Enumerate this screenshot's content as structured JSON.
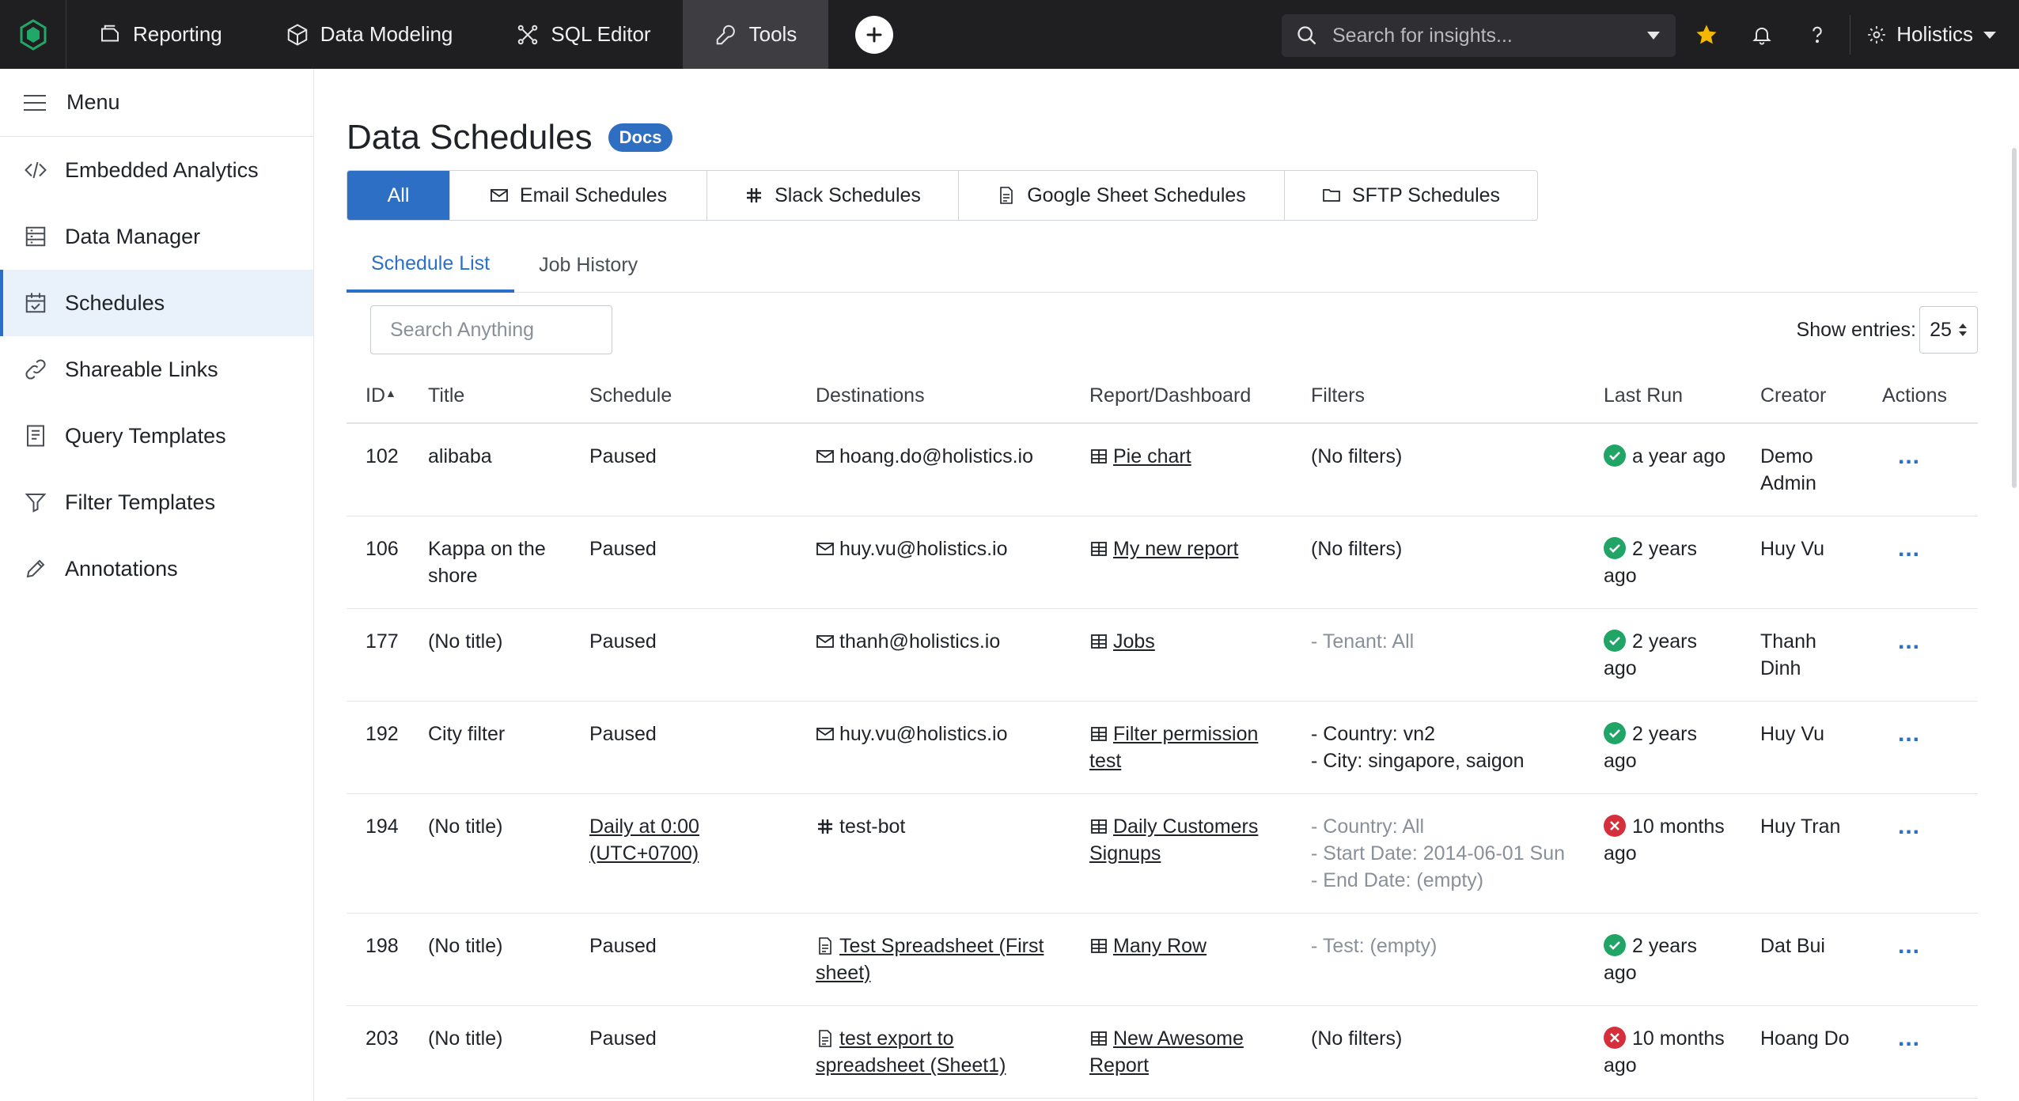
{
  "topbar": {
    "nav": [
      {
        "label": "Reporting",
        "icon": "reporting-icon"
      },
      {
        "label": "Data Modeling",
        "icon": "cube-icon"
      },
      {
        "label": "SQL Editor",
        "icon": "sql-editor-icon"
      },
      {
        "label": "Tools",
        "icon": "wrench-icon"
      }
    ],
    "active_nav": "Tools",
    "search_placeholder": "Search for insights...",
    "account_label": "Holistics",
    "accent_star": "#f5b800"
  },
  "sidebar": {
    "menu_label": "Menu",
    "items": [
      {
        "label": "Embedded Analytics",
        "icon": "code-icon"
      },
      {
        "label": "Data Manager",
        "icon": "data-manager-icon"
      },
      {
        "label": "Schedules",
        "icon": "calendar-check-icon"
      },
      {
        "label": "Shareable Links",
        "icon": "link-icon"
      },
      {
        "label": "Query Templates",
        "icon": "query-template-icon"
      },
      {
        "label": "Filter Templates",
        "icon": "filter-icon"
      },
      {
        "label": "Annotations",
        "icon": "pencil-icon"
      }
    ],
    "active_item": "Schedules"
  },
  "page": {
    "title": "Data Schedules",
    "docs_label": "Docs",
    "type_tabs": [
      "All",
      "Email Schedules",
      "Slack Schedules",
      "Google Sheet Schedules",
      "SFTP Schedules"
    ],
    "sub_tabs": [
      "Schedule List",
      "Job History"
    ],
    "search_placeholder": "Search Anything",
    "show_entries_label": "Show entries:",
    "show_entries_value": "25"
  },
  "table": {
    "columns": [
      "ID",
      "Title",
      "Schedule",
      "Destinations",
      "Report/Dashboard",
      "Filters",
      "Last Run",
      "Creator",
      "Actions"
    ],
    "actions_label": "...",
    "rows": [
      {
        "id": "102",
        "title": "alibaba",
        "schedule": "Paused",
        "destination": "hoang.do@holistics.io",
        "dest_type": "email",
        "report": "Pie chart",
        "filters": [
          "(No filters)"
        ],
        "last_run": "a year ago",
        "status": "success",
        "creator": "Demo Admin"
      },
      {
        "id": "106",
        "title": "Kappa on the shore",
        "schedule": "Paused",
        "destination": "huy.vu@holistics.io",
        "dest_type": "email",
        "report": "My new report",
        "filters": [
          "(No filters)"
        ],
        "last_run": "2 years ago",
        "status": "success",
        "creator": "Huy Vu"
      },
      {
        "id": "177",
        "title": "(No title)",
        "schedule": "Paused",
        "destination": "thanh@holistics.io",
        "dest_type": "email",
        "report": "Jobs",
        "filters": [
          "- Tenant: All"
        ],
        "last_run": "2 years ago",
        "status": "success",
        "creator": "Thanh Dinh"
      },
      {
        "id": "192",
        "title": "City filter",
        "schedule": "Paused",
        "destination": "huy.vu@holistics.io",
        "dest_type": "email",
        "report": "Filter permission test",
        "filters": [
          "- Country: vn2",
          "- City: singapore, saigon"
        ],
        "last_run": "2 years ago",
        "status": "success",
        "creator": "Huy Vu"
      },
      {
        "id": "194",
        "title": "(No title)",
        "schedule": "Daily at 0:00 (UTC+0700)",
        "destination": "test-bot",
        "dest_type": "slack",
        "report": "Daily Customers Signups",
        "filters": [
          "- Country: All",
          "- Start Date: 2014-06-01 Sun",
          "- End Date: (empty)"
        ],
        "last_run": "10 months ago",
        "status": "failed",
        "creator": "Huy Tran"
      },
      {
        "id": "198",
        "title": "(No title)",
        "schedule": "Paused",
        "destination": "Test Spreadsheet (First sheet)",
        "dest_type": "sheet",
        "report": "Many Row",
        "filters": [
          "- Test: (empty)"
        ],
        "last_run": "2 years ago",
        "status": "success",
        "creator": "Dat Bui"
      },
      {
        "id": "203",
        "title": "(No title)",
        "schedule": "Paused",
        "destination": "test export to spreadsheet (Sheet1)",
        "dest_type": "sheet",
        "report": "New Awesome Report",
        "filters": [
          "(No filters)"
        ],
        "last_run": "10 months ago",
        "status": "failed",
        "creator": "Hoang Do"
      }
    ]
  }
}
